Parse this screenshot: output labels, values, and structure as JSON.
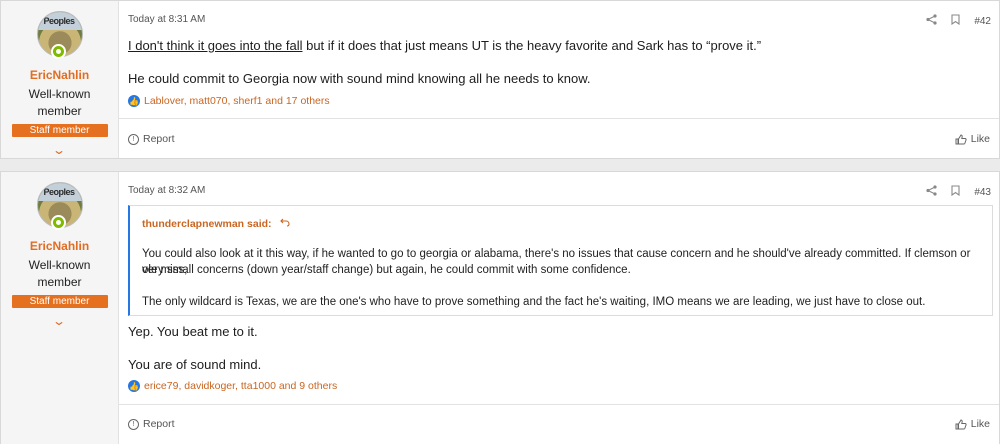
{
  "posts": [
    {
      "user": {
        "name": "EricNahlin",
        "title": "Well-known member",
        "badge": "Staff member",
        "avatar_text": "Peoples"
      },
      "date": "Today at 8:31 AM",
      "number": "#42",
      "body": {
        "link": "I don't think it goes into the fall",
        "line1_rest": " but if it does that just means UT is the heavy favorite and Sark has to “prove it.”",
        "line2": "He could commit to Georgia now with sound mind knowing all he needs to know."
      },
      "reactions": "Lablover, matt070, sherf1 and 17 others",
      "report_label": "Report",
      "like_label": "Like"
    },
    {
      "user": {
        "name": "EricNahlin",
        "title": "Well-known member",
        "badge": "Staff member",
        "avatar_text": "Peoples"
      },
      "date": "Today at 8:32 AM",
      "number": "#43",
      "quote": {
        "author": "thunderclapnewman said:",
        "p1a": "You could also look at it this way, if he wanted to go to georgia or alabama, there's no issues that cause concern and he should've already committed. If clemson or ole miss,",
        "p1b": "very small concerns (down year/staff change) but again, he could commit with some confidence.",
        "p2": "The only wildcard is Texas, we are the one's who have to prove something and the fact he's waiting, IMO means we are leading, we just have to close out."
      },
      "body": {
        "line1": "Yep. You beat me to it.",
        "line2": "You are of sound mind."
      },
      "reactions": "erice79, davidkoger, tta1000 and 9 others",
      "report_label": "Report",
      "like_label": "Like"
    }
  ],
  "icons": {
    "share": "share-icon",
    "bookmark": "bookmark-icon",
    "reply_arrow": "reply-arrow-icon",
    "like_reaction": "thumbs-up-icon",
    "report": "info-icon",
    "chevron": "chevron-down-icon"
  },
  "colors": {
    "accent": "#e16d22",
    "staff_badge": "#e5701f",
    "like_blue": "#2577e3",
    "online": "#7fb900"
  }
}
